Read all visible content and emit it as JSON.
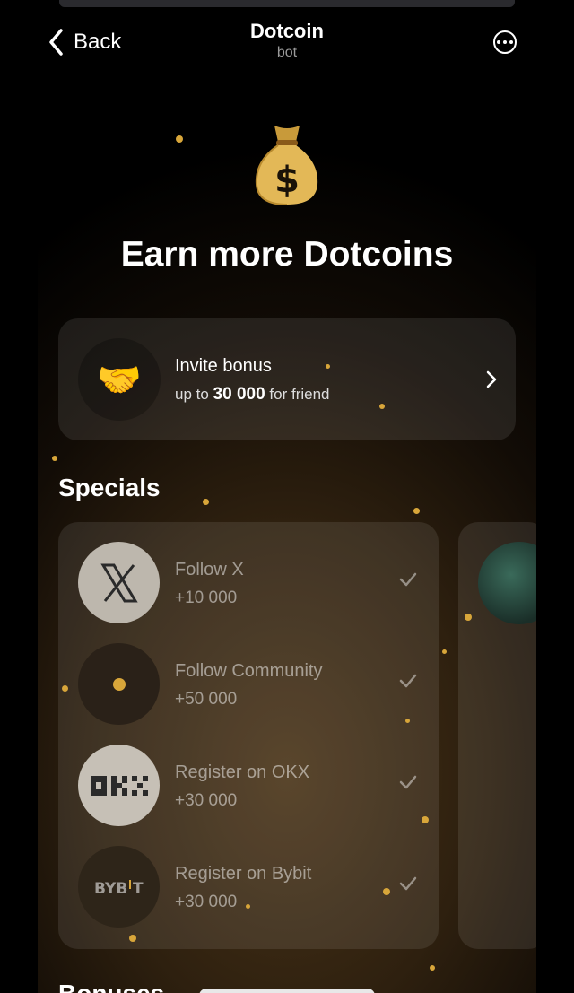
{
  "nav": {
    "back_label": "Back",
    "title": "Dotcoin",
    "subtitle": "bot"
  },
  "hero": {
    "headline": "Earn more Dotcoins",
    "icon": "money-bag-icon"
  },
  "invite": {
    "label": "Invite bonus",
    "sub_prefix": "up to",
    "amount": "30 000",
    "sub_suffix": "for friend",
    "icon": "handshake-icon"
  },
  "specials": {
    "heading": "Specials",
    "tasks": [
      {
        "name": "Follow X",
        "reward": "+10 000",
        "icon": "x-logo-icon",
        "done": true
      },
      {
        "name": "Follow Community",
        "reward": "+50 000",
        "icon": "community-dot-icon",
        "done": true
      },
      {
        "name": "Register on OKX",
        "reward": "+30 000",
        "icon": "okx-logo-icon",
        "done": true
      },
      {
        "name": "Register on Bybit",
        "reward": "+30 000",
        "icon": "bybit-logo-icon",
        "done": true
      }
    ]
  },
  "bonuses": {
    "heading": "Bonuses"
  },
  "colors": {
    "accent_gold": "#d8a63a",
    "background": "#000000"
  }
}
